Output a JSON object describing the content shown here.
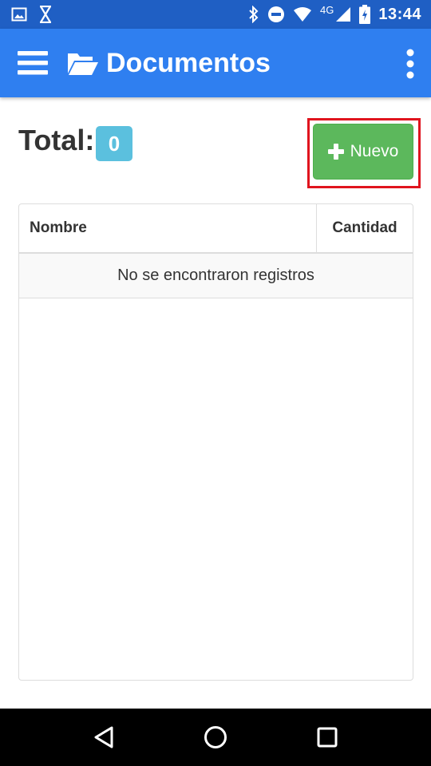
{
  "status_bar": {
    "network_type": "4G",
    "time": "13:44",
    "left_icons": [
      "image-notification-icon",
      "hourglass-notification-icon"
    ],
    "right_icons": [
      "bluetooth-icon",
      "do-not-disturb-icon",
      "wifi-icon",
      "cell-signal-icon",
      "battery-charging-icon"
    ]
  },
  "app_bar": {
    "title": "Documentos",
    "menu_icon": "hamburger-menu-icon",
    "title_icon": "folder-open-icon",
    "overflow_icon": "more-vert-icon",
    "color": "#2f7ff0"
  },
  "summary": {
    "total_label": "Total:",
    "total_count": "0",
    "badge_color": "#5bc0de"
  },
  "actions": {
    "new_label": "Nuevo",
    "new_icon": "plus-icon",
    "new_color": "#5cb85c",
    "highlight_color": "#e0141e"
  },
  "table": {
    "columns": [
      "Nombre",
      "Cantidad"
    ],
    "empty_message": "No se encontraron registros"
  },
  "nav_bar": {
    "buttons": [
      "back-icon",
      "home-icon",
      "recents-icon"
    ]
  }
}
